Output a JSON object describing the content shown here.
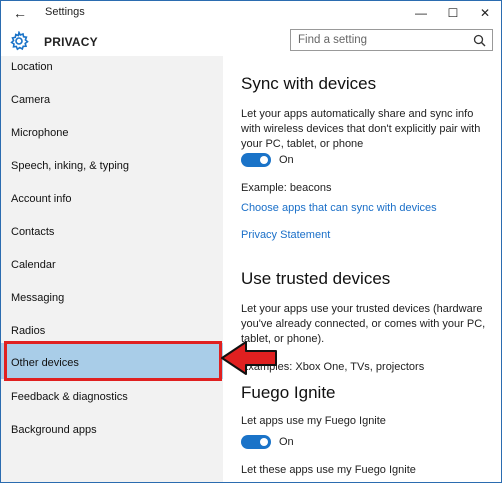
{
  "window": {
    "title": "Settings",
    "back_glyph": "←",
    "minimize_glyph": "—",
    "maximize_glyph": "☐",
    "close_glyph": "✕"
  },
  "header": {
    "title": "PRIVACY",
    "icon": "gear-icon",
    "search": {
      "placeholder": "Find a setting",
      "icon": "search-icon"
    }
  },
  "sidebar": {
    "items": [
      {
        "label": "Location"
      },
      {
        "label": "Camera"
      },
      {
        "label": "Microphone"
      },
      {
        "label": "Speech, inking, & typing"
      },
      {
        "label": "Account info"
      },
      {
        "label": "Contacts"
      },
      {
        "label": "Calendar"
      },
      {
        "label": "Messaging"
      },
      {
        "label": "Radios"
      },
      {
        "label": "Other devices",
        "selected": true
      },
      {
        "label": "Feedback & diagnostics"
      },
      {
        "label": "Background apps"
      }
    ]
  },
  "main": {
    "sync": {
      "heading": "Sync with devices",
      "description": "Let your apps automatically share and sync info with wireless devices that don't explicitly pair with your PC, tablet, or phone",
      "toggle_label": "On",
      "example": "Example: beacons",
      "choose_link": "Choose apps that can sync with devices",
      "privacy_link": "Privacy Statement"
    },
    "trusted": {
      "heading": "Use trusted devices",
      "description": "Let your apps use your trusted devices (hardware you've already connected, or comes with your PC, tablet, or phone).",
      "examples": "Examples: Xbox One, TVs, projectors"
    },
    "fuego": {
      "heading": "Fuego Ignite",
      "description": "Let apps use my Fuego Ignite",
      "toggle_label": "On",
      "sub": "Let these apps use my Fuego Ignite"
    }
  },
  "colors": {
    "accent": "#1a73c8",
    "selected_bg": "#a9cde8",
    "annotation_red": "#e02020"
  }
}
